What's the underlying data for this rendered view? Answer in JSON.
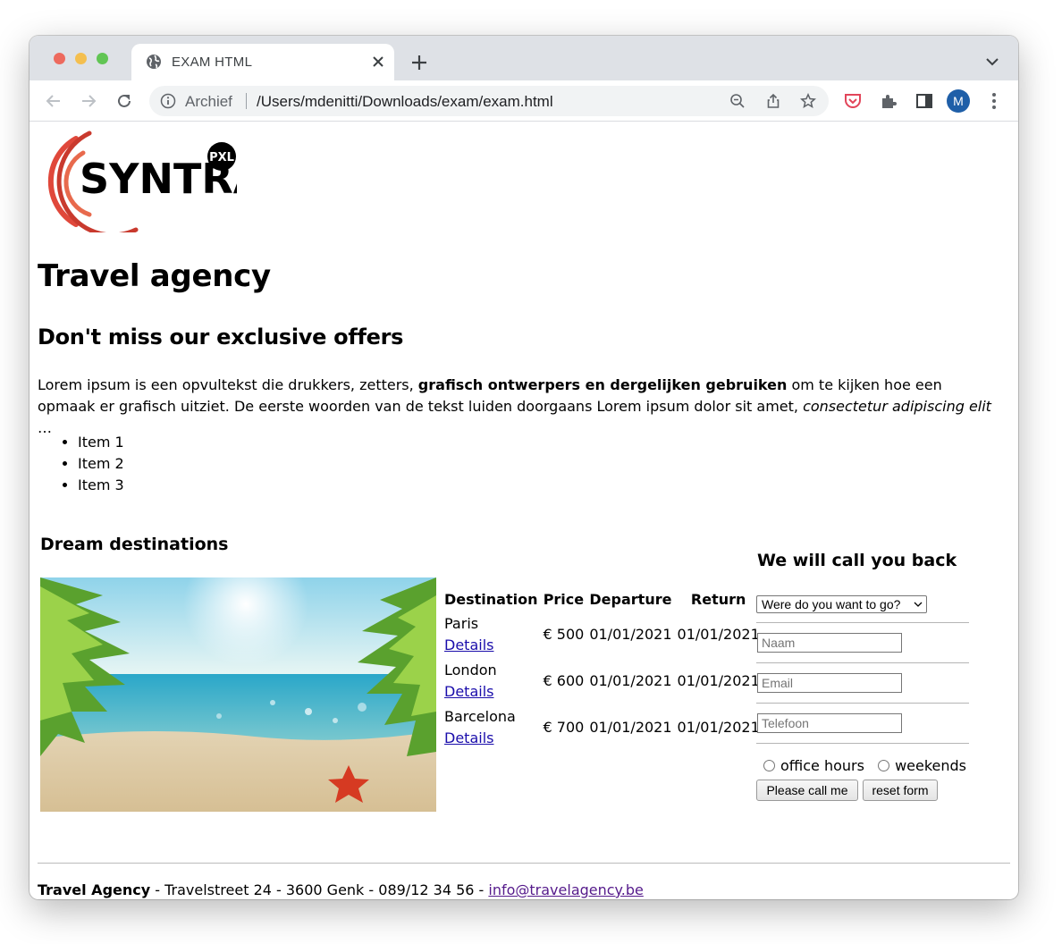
{
  "browser": {
    "tab_title": "EXAM HTML",
    "address_prefix": "Archief",
    "url": "/Users/mdenitti/Downloads/exam/exam.html",
    "profile_initial": "M"
  },
  "page": {
    "logo_text": "SYNTRA",
    "logo_badge": "PXL",
    "title": "Travel agency",
    "subtitle": "Don't miss our exclusive offers",
    "intro": {
      "part1": "Lorem ipsum is een opvultekst die drukkers, zetters, ",
      "bold": "grafisch ontwerpers en dergelijken gebruiken",
      "part2": " om te kijken hoe een opmaak er grafisch uitziet. De eerste woorden van de tekst luiden doorgaans Lorem ipsum dolor sit amet, ",
      "italic": "consectetur adipiscing elit",
      "part3": " …"
    },
    "list_items": [
      "Item 1",
      "Item 2",
      "Item 3"
    ],
    "destinations_title": "Dream destinations",
    "table": {
      "headers": [
        "Destination",
        "Price",
        "Departure",
        "Return"
      ],
      "link_label": "Details",
      "rows": [
        {
          "city": "Paris",
          "price": "€ 500",
          "departure": "01/01/2021",
          "return": "01/01/2021"
        },
        {
          "city": "London",
          "price": "€ 600",
          "departure": "01/01/2021",
          "return": "01/01/2021"
        },
        {
          "city": "Barcelona",
          "price": "€ 700",
          "departure": "01/01/2021",
          "return": "01/01/2021"
        }
      ]
    },
    "form": {
      "title": "We will call you back",
      "select_value": "Were do you want to go?",
      "name_placeholder": "Naam",
      "email_placeholder": "Email",
      "phone_placeholder": "Telefoon",
      "radio_office": "office hours",
      "radio_weekends": "weekends",
      "submit_label": "Please call me",
      "reset_label": "reset form"
    },
    "footer": {
      "company": "Travel Agency",
      "address": " - Travelstreet 24 - 3600 Genk - 089/12 34 56 - ",
      "email": "info@travelagency.be"
    }
  },
  "colors": {
    "logo_red": "#e0483b",
    "link": "#1a0dab",
    "visited_link": "#551a8b",
    "profile": "#1f5fa8"
  }
}
